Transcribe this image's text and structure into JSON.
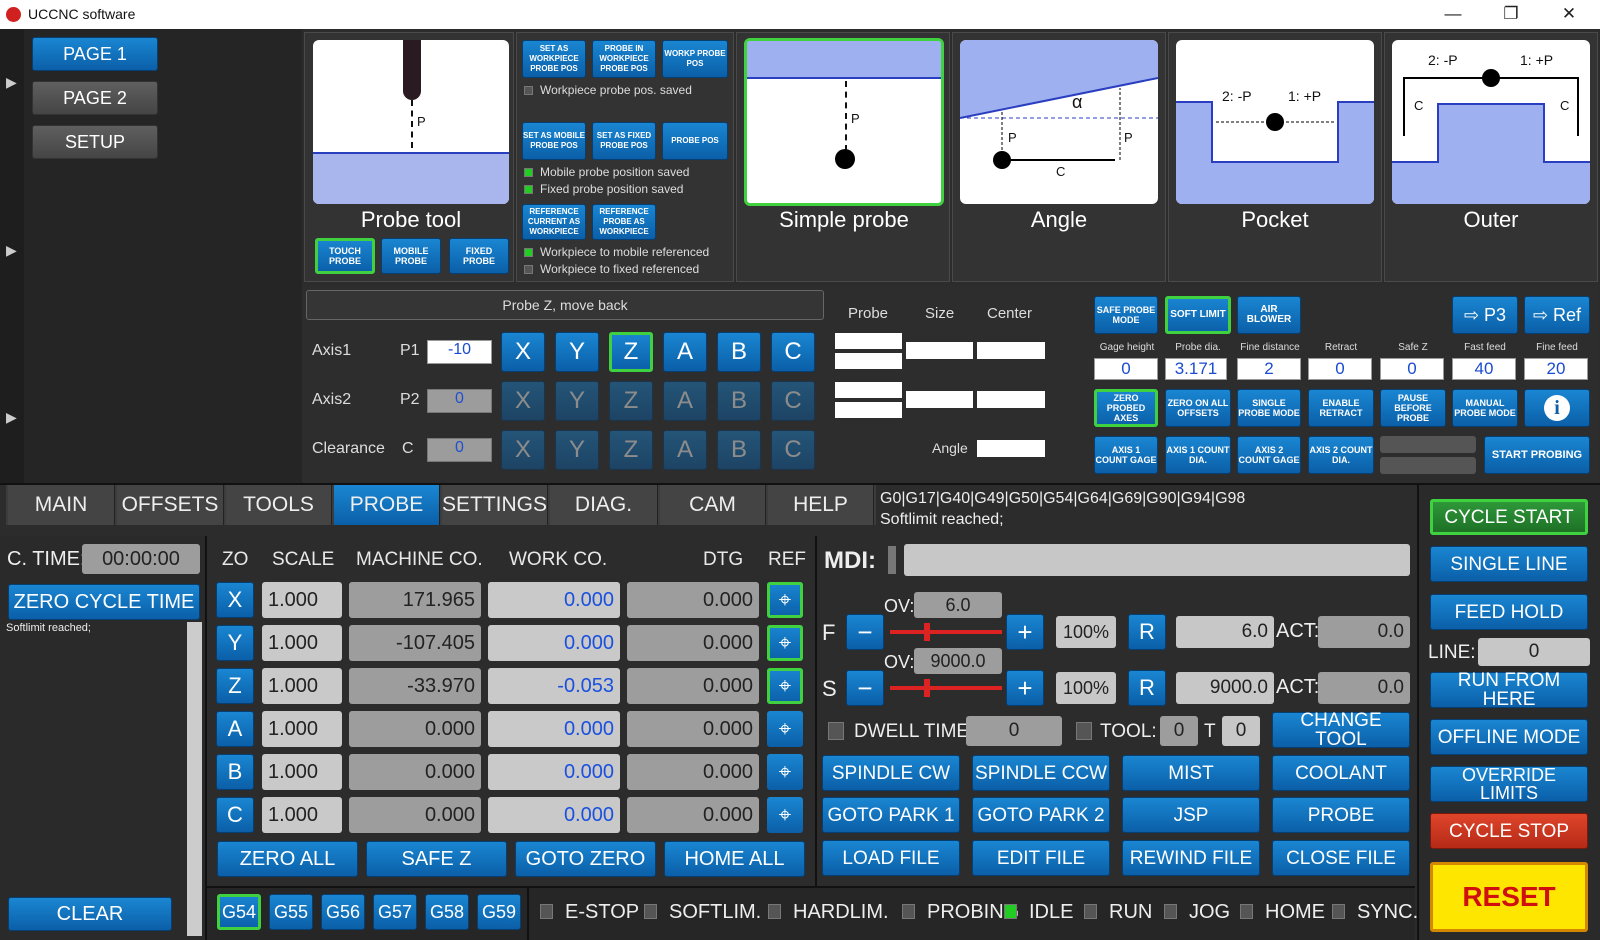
{
  "window": {
    "title": "UCCNC software",
    "min": "—",
    "max": "❐",
    "close": "✕"
  },
  "pages": [
    "PAGE 1",
    "PAGE 2",
    "SETUP"
  ],
  "probe_top": {
    "probe_tool": "Probe tool",
    "touch": "TOUCH PROBE",
    "mobile": "MOBILE PROBE",
    "fixed": "FIXED PROBE",
    "set_wp": "SET AS WORKPIECE PROBE POS",
    "probe_in_wp": "PROBE IN WORKPIECE PROBE POS",
    "wp_probe_pos": "WORKP PROBE POS",
    "wp_saved": "Workpiece probe pos. saved",
    "set_mobile": "SET AS MOBILE PROBE POS",
    "set_fixed": "SET AS FIXED PROBE POS",
    "probe_pos": "PROBE POS",
    "mobile_saved": "Mobile probe position saved",
    "fixed_saved": "Fixed probe position saved",
    "ref_current": "REFERENCE CURRENT AS WORKPIECE",
    "ref_probe": "REFERENCE PROBE AS WORKPIECE",
    "wp_mobile": "Workpiece to mobile referenced",
    "wp_fixed": "Workpiece to fixed referenced",
    "simple": "Simple probe",
    "angle": "Angle",
    "pocket": "Pocket",
    "outer": "Outer",
    "p": "P",
    "c": "C",
    "alpha": "α",
    "neg": "2: -P",
    "pos": "1: +P"
  },
  "probe_mid": {
    "mode": "Probe Z, move back",
    "axis1": "Axis1",
    "p1": "P1",
    "p1_val": "-10",
    "axis2": "Axis2",
    "p2": "P2",
    "p2_val": "0",
    "clear": "Clearance",
    "c": "C",
    "c_val": "0",
    "axes": [
      "X",
      "Y",
      "Z",
      "A",
      "B",
      "C"
    ],
    "col_probe": "Probe",
    "col_size": "Size",
    "col_center": "Center",
    "angle": "Angle"
  },
  "probe_right": {
    "safe": "SAFE PROBE MODE",
    "soft": "SOFT LIMIT",
    "air": "AIR BLOWER",
    "p3": "⇨ P3",
    "ref": "⇨ Ref",
    "params": [
      {
        "l": "Gage height",
        "v": "0"
      },
      {
        "l": "Probe dia.",
        "v": "3.171"
      },
      {
        "l": "Fine distance",
        "v": "2"
      },
      {
        "l": "Retract",
        "v": "0"
      },
      {
        "l": "Safe Z",
        "v": "0"
      },
      {
        "l": "Fast feed",
        "v": "40"
      },
      {
        "l": "Fine feed",
        "v": "20"
      }
    ],
    "zero_probed": "ZERO PROBED AXES",
    "zero_all": "ZERO ON ALL OFFSETS",
    "single": "SINGLE PROBE MODE",
    "enable": "ENABLE RETRACT",
    "pause": "PAUSE BEFORE PROBE",
    "manual": "MANUAL PROBE MODE",
    "info": "i",
    "a1g": "AXIS 1 COUNT GAGE",
    "a1d": "AXIS 1 COUNT DIA.",
    "a2g": "AXIS 2 COUNT GAGE",
    "a2d": "AXIS 2 COUNT DIA.",
    "start": "START PROBING"
  },
  "tabs": [
    "MAIN",
    "OFFSETS",
    "TOOLS",
    "PROBE",
    "SETTINGS",
    "DIAG.",
    "CAM",
    "HELP"
  ],
  "gcodes": "G0|G17|G40|G49|G50|G54|G64|G69|G90|G94|G98",
  "status_msg": "Softlimit reached;",
  "ctime": {
    "label": "C. TIME:",
    "value": "00:00:00",
    "zero": "ZERO CYCLE TIME",
    "log": "Softlimit reached;",
    "clear": "CLEAR"
  },
  "dro": {
    "headers": [
      "ZO",
      "SCALE",
      "MACHINE CO.",
      "WORK CO.",
      "DTG",
      "REF"
    ],
    "rows": [
      {
        "a": "X",
        "s": "1.000",
        "m": "171.965",
        "w": "0.000",
        "d": "0.000"
      },
      {
        "a": "Y",
        "s": "1.000",
        "m": "-107.405",
        "w": "0.000",
        "d": "0.000"
      },
      {
        "a": "Z",
        "s": "1.000",
        "m": "-33.970",
        "w": "-0.053",
        "d": "0.000"
      },
      {
        "a": "A",
        "s": "1.000",
        "m": "0.000",
        "w": "0.000",
        "d": "0.000"
      },
      {
        "a": "B",
        "s": "1.000",
        "m": "0.000",
        "w": "0.000",
        "d": "0.000"
      },
      {
        "a": "C",
        "s": "1.000",
        "m": "0.000",
        "w": "0.000",
        "d": "0.000"
      }
    ],
    "zero_all": "ZERO ALL",
    "safe_z": "SAFE Z",
    "goto_zero": "GOTO ZERO",
    "home_all": "HOME ALL"
  },
  "offsets": [
    "G54",
    "G55",
    "G56",
    "G57",
    "G58",
    "G59"
  ],
  "mdi": {
    "label": "MDI:",
    "value": ""
  },
  "feed": {
    "ov_label": "OV:",
    "ov": "6.0",
    "pct": "100%",
    "r": "R",
    "set": "6.0",
    "act": "ACT:",
    "act_val": "0.0",
    "f": "F",
    "minus": "−",
    "plus": "+"
  },
  "spindle": {
    "ov": "9000.0",
    "pct": "100%",
    "set": "9000.0",
    "act_val": "0.0",
    "s": "S"
  },
  "dwell": {
    "label": "DWELL TIME:",
    "value": "0",
    "tool": "TOOL:",
    "tool_val": "0",
    "t": "T",
    "t_val": "0",
    "change": "CHANGE TOOL"
  },
  "ctrl": [
    "SPINDLE CW",
    "SPINDLE CCW",
    "MIST",
    "COOLANT",
    "GOTO PARK 1",
    "GOTO PARK 2",
    "JSP",
    "PROBE",
    "LOAD FILE",
    "EDIT FILE",
    "REWIND FILE",
    "CLOSE FILE"
  ],
  "status": [
    {
      "l": "E-STOP",
      "on": false
    },
    {
      "l": "SOFTLIM.",
      "on": false
    },
    {
      "l": "HARDLIM.",
      "on": false
    },
    {
      "l": "PROBING",
      "on": false
    },
    {
      "l": "IDLE",
      "on": true
    },
    {
      "l": "RUN",
      "on": false
    },
    {
      "l": "JOG",
      "on": false
    },
    {
      "l": "HOME",
      "on": false
    },
    {
      "l": "SYNC.",
      "on": false
    }
  ],
  "right": {
    "cycle_start": "CYCLE START",
    "single_line": "SINGLE LINE",
    "feed_hold": "FEED HOLD",
    "line": "LINE:",
    "line_val": "0",
    "run_from": "RUN FROM HERE",
    "offline": "OFFLINE MODE",
    "override": "OVERRIDE LIMITS",
    "cycle_stop": "CYCLE STOP",
    "reset": "RESET"
  }
}
